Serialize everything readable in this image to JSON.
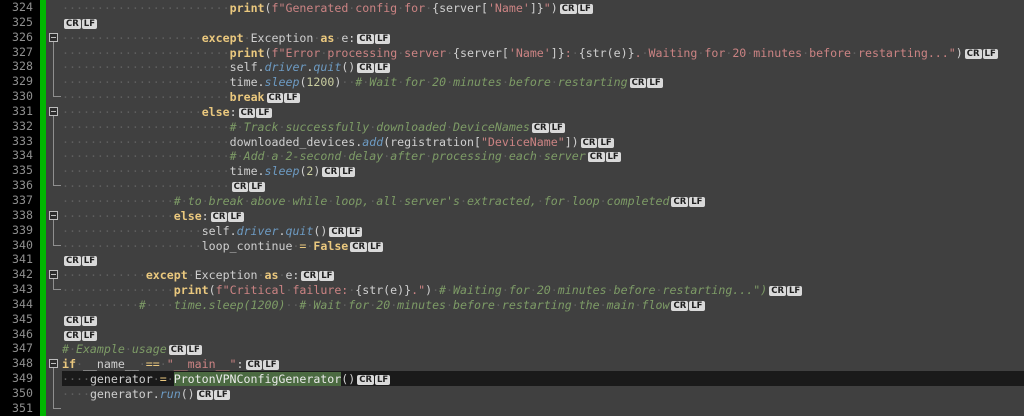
{
  "eol_marker": {
    "cr": "CR",
    "lf": "LF"
  },
  "colors": {
    "editor_bg": "#404040",
    "current_line_bg": "#1a1a1a",
    "margin_bg": "#000000",
    "line_number": "#8f8f8f",
    "change_bar": "#00b600",
    "fold_line": "#8f8f8f",
    "fold_box": "#bdbdbd",
    "default_text": "#cfcfcf",
    "keyword": "#eac87e",
    "string": "#cb8383",
    "comment": "#7d9b66",
    "method": "#6d9bc3",
    "number": "#c9cda0",
    "whitespace_dot": "#5e5e5e",
    "highlight_bg": "#4b6a41",
    "eol_bg": "#d9d9d9",
    "eol_text": "#1f1f1f"
  },
  "editor": {
    "first_line": 324,
    "last_line": 351,
    "lines": [
      {
        "num": 324,
        "fold": "",
        "current": false,
        "eol": true,
        "tokens": [
          {
            "t": "                        ",
            "c": "d"
          },
          {
            "t": "print",
            "c": "k"
          },
          {
            "t": "(",
            "c": "d"
          },
          {
            "t": "f\"Generated config for ",
            "c": "s"
          },
          {
            "t": "{server[",
            "c": "d"
          },
          {
            "t": "'Name'",
            "c": "s"
          },
          {
            "t": "]}",
            "c": "d"
          },
          {
            "t": "\"",
            "c": "s"
          },
          {
            "t": ")",
            "c": "d"
          }
        ]
      },
      {
        "num": 325,
        "fold": "",
        "current": false,
        "eol": true,
        "tokens": []
      },
      {
        "num": 326,
        "fold": "box",
        "current": false,
        "eol": true,
        "tokens": [
          {
            "t": "                    ",
            "c": "d"
          },
          {
            "t": "except",
            "c": "k"
          },
          {
            "t": " Exception ",
            "c": "d"
          },
          {
            "t": "as",
            "c": "k"
          },
          {
            "t": " e:",
            "c": "d"
          }
        ]
      },
      {
        "num": 327,
        "fold": "line",
        "current": false,
        "eol": true,
        "tokens": [
          {
            "t": "                        ",
            "c": "d"
          },
          {
            "t": "print",
            "c": "k"
          },
          {
            "t": "(",
            "c": "d"
          },
          {
            "t": "f\"Error processing server ",
            "c": "s"
          },
          {
            "t": "{server[",
            "c": "d"
          },
          {
            "t": "'Name'",
            "c": "s"
          },
          {
            "t": "]}",
            "c": "d"
          },
          {
            "t": ": ",
            "c": "s"
          },
          {
            "t": "{str(e)}",
            "c": "d"
          },
          {
            "t": ". Waiting for 20 minutes before restarting...\"",
            "c": "s"
          },
          {
            "t": ")",
            "c": "d"
          }
        ]
      },
      {
        "num": 328,
        "fold": "line",
        "current": false,
        "eol": true,
        "tokens": [
          {
            "t": "                        ",
            "c": "d"
          },
          {
            "t": "self.",
            "c": "d"
          },
          {
            "t": "driver",
            "c": "m"
          },
          {
            "t": ".",
            "c": "d"
          },
          {
            "t": "quit",
            "c": "m"
          },
          {
            "t": "()",
            "c": "d"
          }
        ]
      },
      {
        "num": 329,
        "fold": "line",
        "current": false,
        "eol": true,
        "tokens": [
          {
            "t": "                        ",
            "c": "d"
          },
          {
            "t": "time.",
            "c": "d"
          },
          {
            "t": "sleep",
            "c": "m"
          },
          {
            "t": "(",
            "c": "d"
          },
          {
            "t": "1200",
            "c": "n"
          },
          {
            "t": ")  ",
            "c": "d"
          },
          {
            "t": "# Wait for 20 minutes before restarting",
            "c": "c"
          }
        ]
      },
      {
        "num": 330,
        "fold": "end",
        "current": false,
        "eol": true,
        "tokens": [
          {
            "t": "                        ",
            "c": "d"
          },
          {
            "t": "break",
            "c": "k"
          }
        ]
      },
      {
        "num": 331,
        "fold": "box",
        "current": false,
        "eol": true,
        "tokens": [
          {
            "t": "                    ",
            "c": "d"
          },
          {
            "t": "else",
            "c": "k"
          },
          {
            "t": ":",
            "c": "d"
          }
        ]
      },
      {
        "num": 332,
        "fold": "line",
        "current": false,
        "eol": true,
        "tokens": [
          {
            "t": "                        ",
            "c": "d"
          },
          {
            "t": "# Track successfully downloaded DeviceNames",
            "c": "c"
          }
        ]
      },
      {
        "num": 333,
        "fold": "line",
        "current": false,
        "eol": true,
        "tokens": [
          {
            "t": "                        ",
            "c": "d"
          },
          {
            "t": "downloaded_devices.",
            "c": "d"
          },
          {
            "t": "add",
            "c": "m"
          },
          {
            "t": "(registration[",
            "c": "d"
          },
          {
            "t": "\"DeviceName\"",
            "c": "s"
          },
          {
            "t": "])",
            "c": "d"
          }
        ]
      },
      {
        "num": 334,
        "fold": "line",
        "current": false,
        "eol": true,
        "tokens": [
          {
            "t": "                        ",
            "c": "d"
          },
          {
            "t": "# Add a 2-second delay after processing each server",
            "c": "c"
          }
        ]
      },
      {
        "num": 335,
        "fold": "line",
        "current": false,
        "eol": true,
        "tokens": [
          {
            "t": "                        ",
            "c": "d"
          },
          {
            "t": "time.",
            "c": "d"
          },
          {
            "t": "sleep",
            "c": "m"
          },
          {
            "t": "(",
            "c": "d"
          },
          {
            "t": "2",
            "c": "n"
          },
          {
            "t": ")",
            "c": "d"
          }
        ]
      },
      {
        "num": 336,
        "fold": "end",
        "current": false,
        "eol": true,
        "tokens": [
          {
            "t": "                        ",
            "c": "d"
          }
        ]
      },
      {
        "num": 337,
        "fold": "",
        "current": false,
        "eol": true,
        "tokens": [
          {
            "t": "                ",
            "c": "d"
          },
          {
            "t": "# to break above while loop, all server's extracted, for loop completed",
            "c": "c"
          }
        ]
      },
      {
        "num": 338,
        "fold": "box",
        "current": false,
        "eol": true,
        "tokens": [
          {
            "t": "                ",
            "c": "d"
          },
          {
            "t": "else",
            "c": "k"
          },
          {
            "t": ":",
            "c": "d"
          }
        ]
      },
      {
        "num": 339,
        "fold": "line",
        "current": false,
        "eol": true,
        "tokens": [
          {
            "t": "                    ",
            "c": "d"
          },
          {
            "t": "self.",
            "c": "d"
          },
          {
            "t": "driver",
            "c": "m"
          },
          {
            "t": ".",
            "c": "d"
          },
          {
            "t": "quit",
            "c": "m"
          },
          {
            "t": "()",
            "c": "d"
          }
        ]
      },
      {
        "num": 340,
        "fold": "end",
        "current": false,
        "eol": true,
        "tokens": [
          {
            "t": "                    ",
            "c": "d"
          },
          {
            "t": "loop_continue ",
            "c": "d"
          },
          {
            "t": "=",
            "c": "o"
          },
          {
            "t": " ",
            "c": "d"
          },
          {
            "t": "False",
            "c": "k"
          }
        ]
      },
      {
        "num": 341,
        "fold": "",
        "current": false,
        "eol": true,
        "tokens": []
      },
      {
        "num": 342,
        "fold": "box",
        "current": false,
        "eol": true,
        "tokens": [
          {
            "t": "            ",
            "c": "d"
          },
          {
            "t": "except",
            "c": "k"
          },
          {
            "t": " Exception ",
            "c": "d"
          },
          {
            "t": "as",
            "c": "k"
          },
          {
            "t": " e:",
            "c": "d"
          }
        ]
      },
      {
        "num": 343,
        "fold": "end",
        "current": false,
        "eol": true,
        "tokens": [
          {
            "t": "                ",
            "c": "d"
          },
          {
            "t": "print",
            "c": "k"
          },
          {
            "t": "(",
            "c": "d"
          },
          {
            "t": "f\"Critical failure: ",
            "c": "s"
          },
          {
            "t": "{str(e)}",
            "c": "d"
          },
          {
            "t": ".\"",
            "c": "s"
          },
          {
            "t": ") ",
            "c": "d"
          },
          {
            "t": "# Waiting for 20 minutes before restarting...\")",
            "c": "c"
          }
        ]
      },
      {
        "num": 344,
        "fold": "",
        "current": false,
        "eol": true,
        "tokens": [
          {
            "t": "           ",
            "c": "d"
          },
          {
            "t": "#    time.sleep(1200)  # Wait for 20 minutes before restarting the main flow",
            "c": "c"
          }
        ]
      },
      {
        "num": 345,
        "fold": "",
        "current": false,
        "eol": true,
        "tokens": []
      },
      {
        "num": 346,
        "fold": "",
        "current": false,
        "eol": true,
        "tokens": []
      },
      {
        "num": 347,
        "fold": "",
        "current": false,
        "eol": true,
        "tokens": [
          {
            "t": "# Example usage",
            "c": "c"
          }
        ]
      },
      {
        "num": 348,
        "fold": "box",
        "current": false,
        "eol": true,
        "tokens": [
          {
            "t": "if",
            "c": "k"
          },
          {
            "t": " __name__ ",
            "c": "d"
          },
          {
            "t": "==",
            "c": "o"
          },
          {
            "t": " ",
            "c": "d"
          },
          {
            "t": "\"__main__\"",
            "c": "s"
          },
          {
            "t": ":",
            "c": "d"
          }
        ]
      },
      {
        "num": 349,
        "fold": "line",
        "current": true,
        "eol": true,
        "tokens": [
          {
            "t": "    ",
            "c": "d"
          },
          {
            "t": "generator ",
            "c": "d"
          },
          {
            "t": "=",
            "c": "o"
          },
          {
            "t": " ",
            "c": "d"
          },
          {
            "t": "ProtonVPNConfigGenerator",
            "c": "hl"
          },
          {
            "t": "()",
            "c": "d"
          }
        ]
      },
      {
        "num": 350,
        "fold": "line",
        "current": false,
        "eol": true,
        "tokens": [
          {
            "t": "    ",
            "c": "d"
          },
          {
            "t": "generator.",
            "c": "d"
          },
          {
            "t": "run",
            "c": "m"
          },
          {
            "t": "()",
            "c": "d"
          }
        ]
      },
      {
        "num": 351,
        "fold": "end",
        "current": false,
        "eol": false,
        "tokens": []
      }
    ]
  }
}
